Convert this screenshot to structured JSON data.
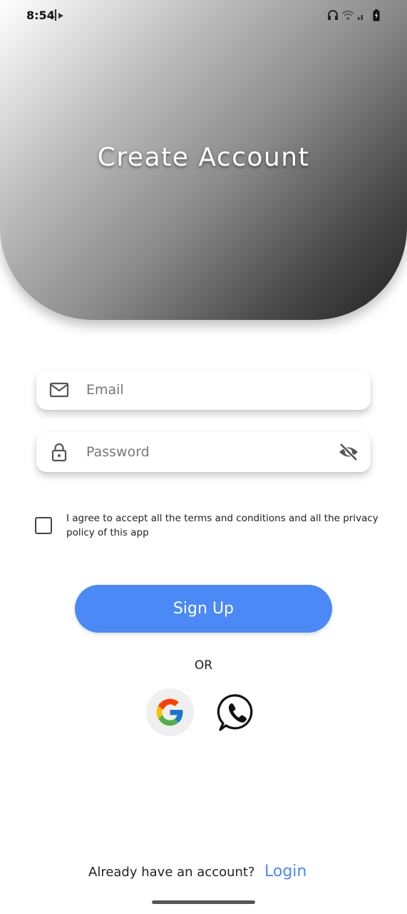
{
  "status_bar": {
    "time": "8:54",
    "icons": [
      "b-notification-icon",
      "headphones-icon",
      "wifi-icon",
      "signal-icon",
      "battery-charging-icon"
    ]
  },
  "header": {
    "title": "Create Account",
    "gradient_colors": [
      "#ffffff",
      "#222222"
    ]
  },
  "form": {
    "email": {
      "placeholder": "Email",
      "value": "",
      "icon": "mail-icon"
    },
    "password": {
      "placeholder": "Password",
      "value": "",
      "icon": "lock-icon",
      "toggle_icon": "eye-off-icon"
    },
    "terms": {
      "checked": false,
      "text": "I agree to accept all the terms and conditions and all the privacy policy of this app"
    },
    "submit_label": "Sign Up"
  },
  "divider_text": "OR",
  "social": [
    {
      "name": "Google",
      "icon": "google-icon"
    },
    {
      "name": "WhatsApp",
      "icon": "whatsapp-icon"
    }
  ],
  "footer": {
    "prompt": "Already have an account?",
    "login_label": "Login"
  },
  "colors": {
    "accent": "#4b8af6",
    "text": "#222222"
  }
}
